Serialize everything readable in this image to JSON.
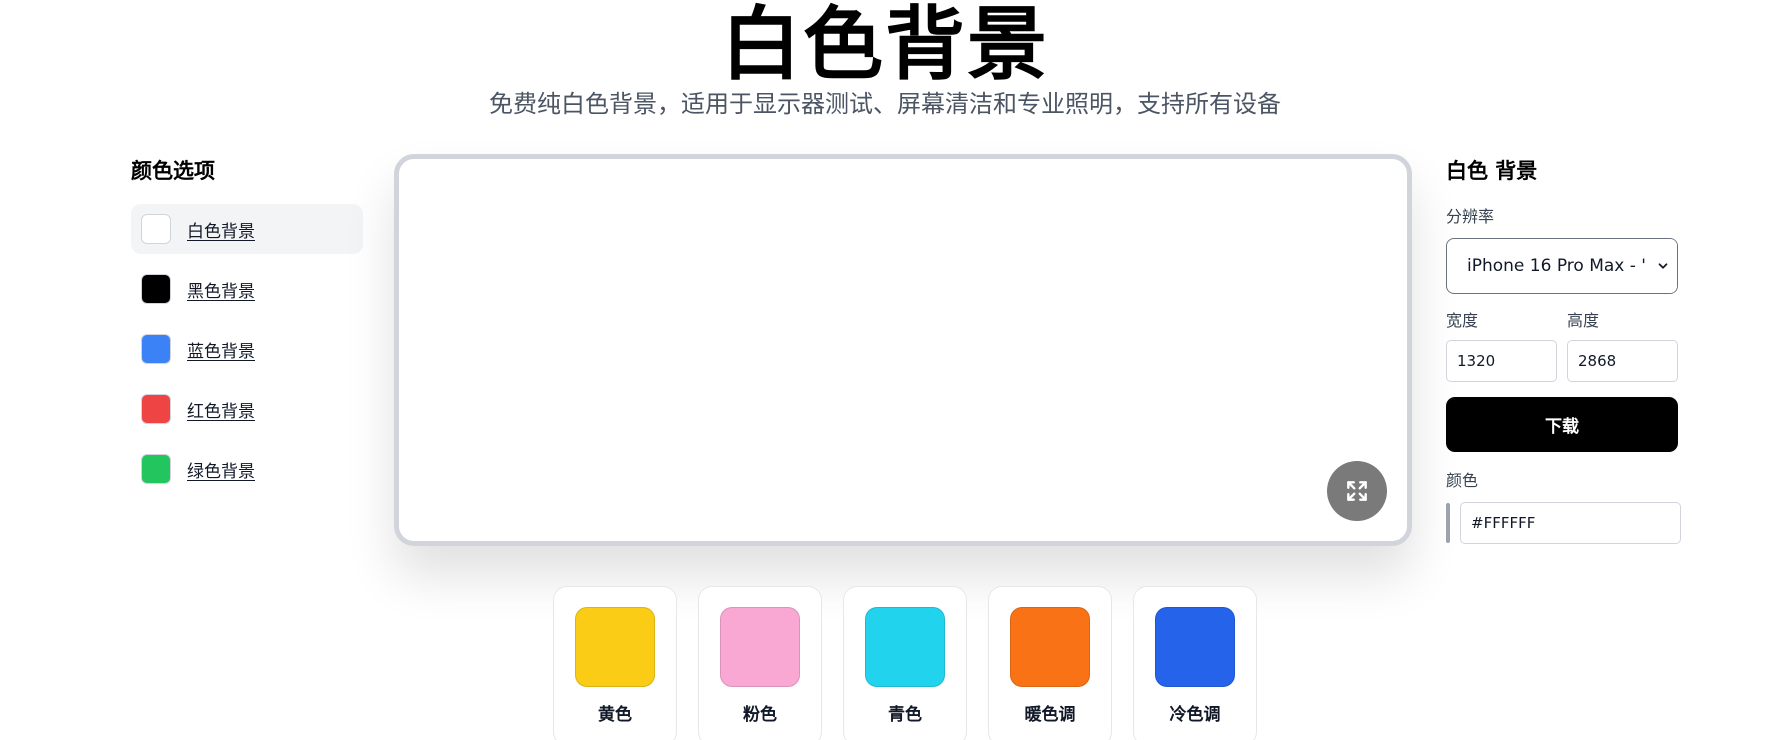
{
  "header": {
    "title": "白色背景",
    "subtitle": "免费纯白色背景，适用于显示器测试、屏幕清洁和专业照明，支持所有设备"
  },
  "sidebar": {
    "title": "颜色选项",
    "items": [
      {
        "label": "白色背景",
        "color": "#FFFFFF",
        "active": true
      },
      {
        "label": "黑色背景",
        "color": "#000000",
        "active": false
      },
      {
        "label": "蓝色背景",
        "color": "#3B82F6",
        "active": false
      },
      {
        "label": "红色背景",
        "color": "#EF4444",
        "active": false
      },
      {
        "label": "绿色背景",
        "color": "#22C55E",
        "active": false
      }
    ]
  },
  "preview": {
    "background": "#FFFFFF",
    "fullscreen_icon": "expand-icon"
  },
  "panel": {
    "title": "白色 背景",
    "resolution_label": "分辨率",
    "resolution_value": "iPhone 16 Pro Max - '",
    "width_label": "宽度",
    "width_value": "1320",
    "height_label": "高度",
    "height_value": "2868",
    "download_label": "下载",
    "color_label": "颜色",
    "color_value": "#FFFFFF"
  },
  "more_colors": [
    {
      "label": "黄色",
      "color": "#FACC15"
    },
    {
      "label": "粉色",
      "color": "#F9A8D4"
    },
    {
      "label": "青色",
      "color": "#22D3EE"
    },
    {
      "label": "暖色调",
      "color": "#F97316"
    },
    {
      "label": "冷色调",
      "color": "#2563EB"
    }
  ]
}
